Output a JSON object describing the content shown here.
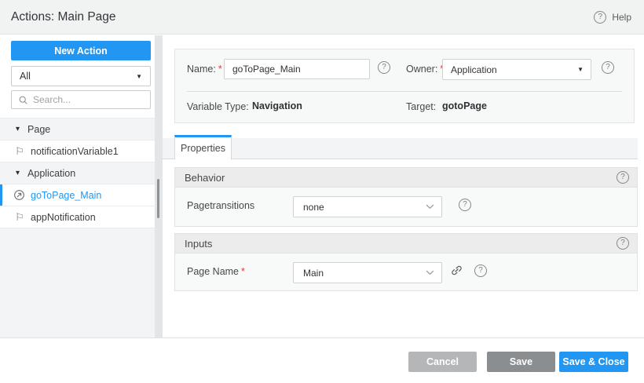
{
  "header": {
    "title": "Actions: Main Page",
    "help_label": "Help"
  },
  "sidebar": {
    "new_action_label": "New Action",
    "filter_value": "All",
    "search_placeholder": "Search...",
    "tree": [
      {
        "type": "group",
        "label": "Page"
      },
      {
        "type": "item",
        "label": "notificationVariable1",
        "icon": "flag"
      },
      {
        "type": "group",
        "label": "Application"
      },
      {
        "type": "item",
        "label": "goToPage_Main",
        "icon": "goto-page",
        "selected": true
      },
      {
        "type": "item",
        "label": "appNotification",
        "icon": "flag"
      }
    ]
  },
  "form": {
    "name_label": "Name:",
    "name_value": "goToPage_Main",
    "owner_label": "Owner:",
    "owner_value": "Application",
    "variable_type_label": "Variable Type:",
    "variable_type_value": "Navigation",
    "target_label": "Target:",
    "target_value": "gotoPage"
  },
  "tabs": {
    "properties_label": "Properties"
  },
  "sections": {
    "behavior": {
      "title": "Behavior",
      "field_label": "Pagetransitions",
      "field_value": "none"
    },
    "inputs": {
      "title": "Inputs",
      "field_label": "Page Name",
      "field_value": "Main"
    }
  },
  "footer": {
    "cancel_label": "Cancel",
    "save_label": "Save",
    "save_close_label": "Save & Close"
  },
  "misc": {
    "required_mark": "*"
  },
  "icons": {
    "help_glyph": "?",
    "caret_down": "▾",
    "select_arrow": "▼",
    "flag_glyph": "⚐"
  },
  "colors": {
    "accent": "#2196f3",
    "save_button": "#8b8e90",
    "cancel_button": "#b4b6b8"
  }
}
